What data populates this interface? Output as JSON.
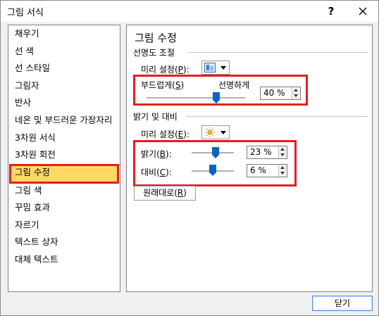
{
  "window": {
    "title": "그림 서식",
    "help_glyph": "?"
  },
  "categories": [
    {
      "label": "채우기",
      "selected": false
    },
    {
      "label": "선 색",
      "selected": false
    },
    {
      "label": "선 스타일",
      "selected": false
    },
    {
      "label": "그림자",
      "selected": false
    },
    {
      "label": "반사",
      "selected": false
    },
    {
      "label": "네온 및 부드러운 가장자리",
      "selected": false
    },
    {
      "label": "3차원 서식",
      "selected": false
    },
    {
      "label": "3차원 회전",
      "selected": false
    },
    {
      "label": "그림 수정",
      "selected": true
    },
    {
      "label": "그림 색",
      "selected": false
    },
    {
      "label": "꾸밈 효과",
      "selected": false
    },
    {
      "label": "자르기",
      "selected": false
    },
    {
      "label": "텍스트 상자",
      "selected": false
    },
    {
      "label": "대체 텍스트",
      "selected": false
    }
  ],
  "panel": {
    "title": "그림 수정",
    "sharpness": {
      "group_label": "선명도 조절",
      "preset_label": "미리 설정(",
      "preset_key": "P",
      "preset_icon": "sharpen-preset-icon",
      "soft_label": "부드럽게(",
      "soft_key": "S",
      "sharp_label": "선명하게",
      "value_text": "40 %",
      "value": 40
    },
    "brightness_contrast": {
      "group_label": "밝기 및 대비",
      "preset_label": "미리 설정(",
      "preset_key": "E",
      "preset_icon": "brightness-sun-icon",
      "brightness_label": "밝기(",
      "brightness_key": "B",
      "brightness_value_text": "23 %",
      "brightness_value": 23,
      "contrast_label": "대비(",
      "contrast_key": "C",
      "contrast_value_text": "6 %",
      "contrast_value": 6
    },
    "reset_label": "원래대로(",
    "reset_key": "R"
  },
  "footer": {
    "close_label": "닫기"
  },
  "colors": {
    "highlight": "#e0201e",
    "selected_bg": "#ffd966",
    "thumb": "#0a64c8"
  }
}
